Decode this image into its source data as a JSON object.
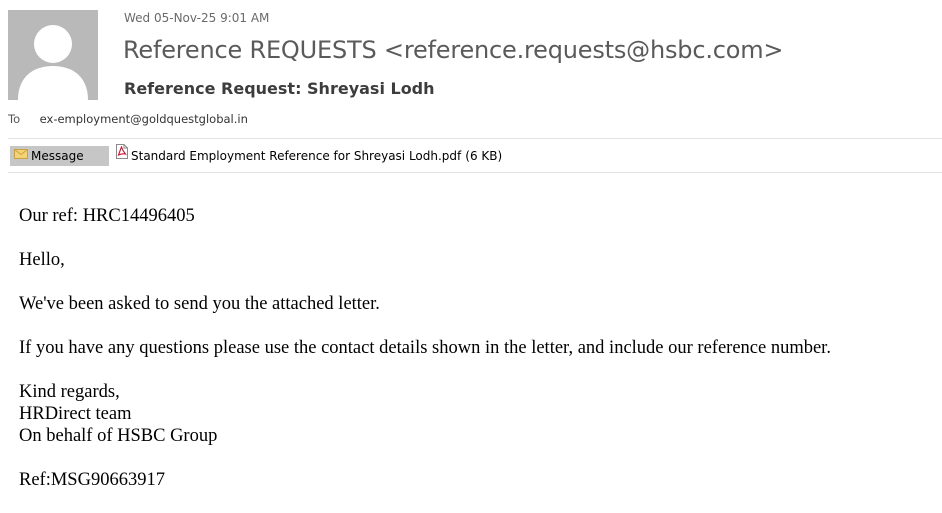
{
  "message": {
    "date": "Wed 05-Nov-25 9:01 AM",
    "sender": "Reference REQUESTS <reference.requests@hsbc.com>",
    "subject": "Reference Request: Shreyasi Lodh",
    "to_label": "To",
    "to_address": "ex-employment@goldquestglobal.in"
  },
  "tabs": {
    "message_label": "Message",
    "message_icon": "envelope-icon"
  },
  "attachment": {
    "icon": "pdf-file-icon",
    "filename": "Standard Employment Reference for Shreyasi Lodh.pdf",
    "size": "(6 KB)"
  },
  "body": {
    "our_ref": "Our ref: HRC14496405",
    "greeting": "Hello,",
    "line1": "We've been asked to send you the attached letter.",
    "line2": "If you have any questions please use the contact details shown in the letter, and include our reference number.",
    "closing": "Kind regards,",
    "team": "HRDirect team",
    "on_behalf": "On behalf of HSBC Group",
    "ref": "Ref:MSG90663917"
  },
  "colors": {
    "avatar_bg": "#b9b9b9",
    "tab_bg": "#c6c6c6",
    "pdf_red": "#c8102e"
  }
}
